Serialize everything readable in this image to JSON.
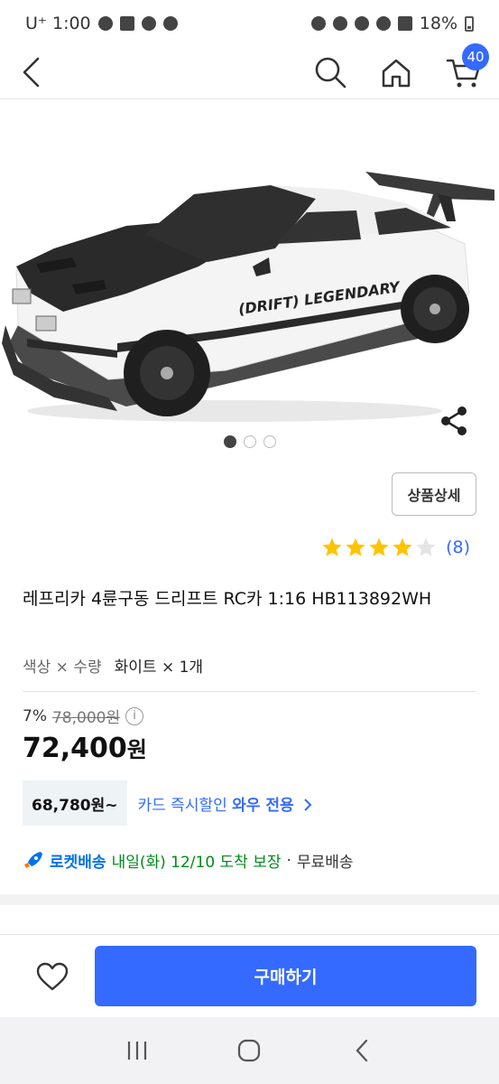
{
  "status_bar": {
    "carrier_time": "U⁺ 1:00",
    "battery": "18%"
  },
  "header": {
    "cart_count": "40",
    "icons": [
      "back-icon",
      "search-icon",
      "home-icon",
      "cart-icon"
    ]
  },
  "gallery": {
    "image_count": 3,
    "active_index": 0,
    "decal_text": "(DRIFT) LEGENDARY"
  },
  "product": {
    "detail_button": "상품상세",
    "rating": 4,
    "rating_max": 5,
    "review_count": "(8)",
    "title": "레프리카 4륜구동 드리프트 RC카 1:16 HB113892WH",
    "option_label": "색상 × 수량",
    "option_value": "화이트 × 1개",
    "discount_rate": "7%",
    "original_price": "78,000원",
    "sale_price_number": "72,400",
    "sale_price_unit": "원",
    "card_price": "68,780원~",
    "card_text": "카드 즉시할인",
    "card_text_bold": "와우 전용",
    "rocket_label": "로켓배송",
    "delivery_text": "내일(화) 12/10 도착 보장",
    "separator": "·",
    "free_shipping": "무료배송"
  },
  "bottom_bar": {
    "buy_label": "구매하기"
  },
  "colors": {
    "accent": "#346aff",
    "rocket": "#0073e9",
    "delivery": "#00891a",
    "star": "#ffc400"
  }
}
